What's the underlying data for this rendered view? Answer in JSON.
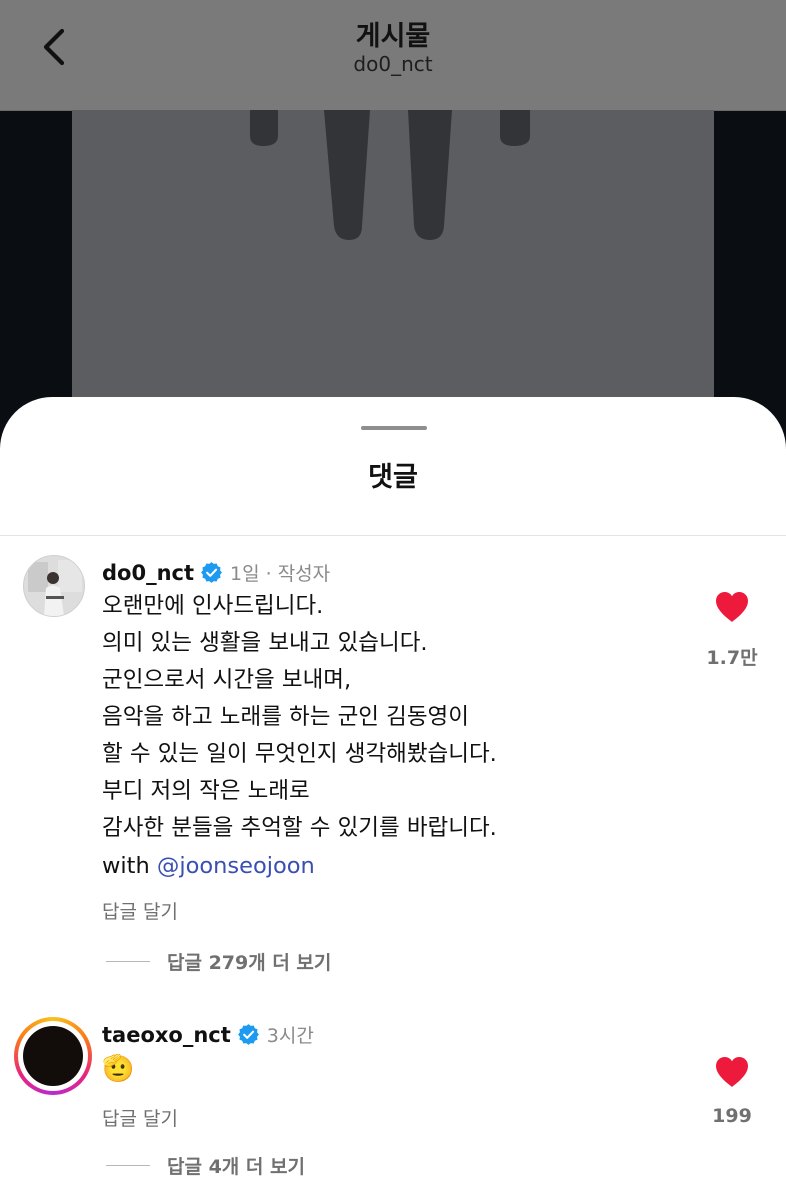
{
  "header": {
    "title": "게시물",
    "subtitle": "do0_nct"
  },
  "sheet": {
    "title": "댓글"
  },
  "comments": [
    {
      "username": "do0_nct",
      "verified": true,
      "time": "1일 · 작성자",
      "lines": [
        "오랜만에 인사드립니다.",
        "의미 있는 생활을 보내고 있습니다.",
        "군인으로서 시간을 보내며,",
        "음악을 하고 노래를 하는 군인 김동영이",
        "할 수 있는 일이 무엇인지 생각해봤습니다.",
        "부디 저의 작은 노래로",
        "감사한 분들을 추억할 수 있기를 바랍니다."
      ],
      "with_prefix": "with ",
      "mention": "@joonseojoon",
      "reply_label": "답글 달기",
      "view_replies": "답글 279개 더 보기",
      "likes": "1.7만",
      "liked": true
    },
    {
      "username": "taeoxo_nct",
      "verified": true,
      "time": "3시간",
      "emoji": "🫡",
      "reply_label": "답글 달기",
      "view_replies": "답글 4개 더 보기",
      "likes": "199",
      "liked": true
    }
  ],
  "colors": {
    "verified": "#1d9bf0",
    "heart": "#ed1a3b",
    "mention": "#3a4fb3"
  }
}
